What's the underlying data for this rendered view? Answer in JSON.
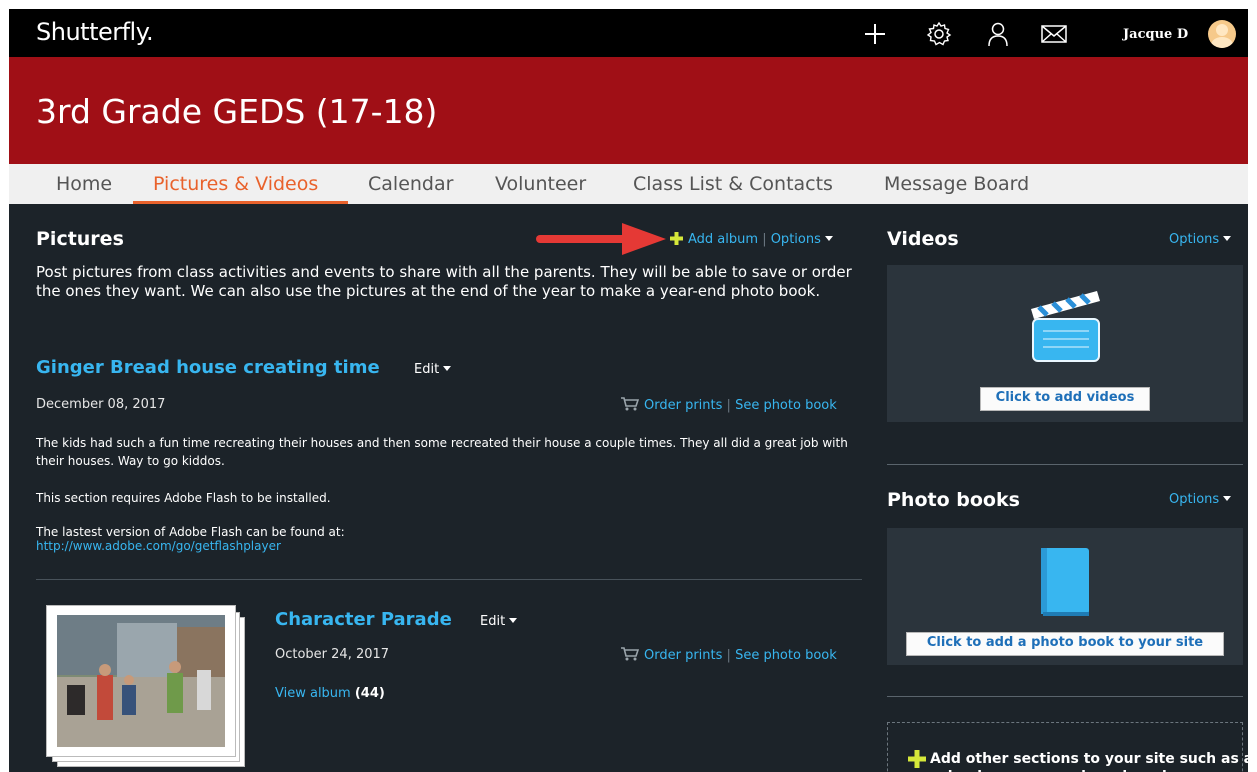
{
  "header": {
    "logo": "Shutterfly.",
    "user_name": "Jacque D",
    "icons": [
      "plus-icon",
      "gear-icon",
      "person-icon",
      "mail-icon"
    ]
  },
  "banner": {
    "title": "3rd Grade GEDS (17-18)"
  },
  "nav": {
    "items": [
      "Home",
      "Pictures & Videos",
      "Calendar",
      "Volunteer",
      "Class List & Contacts",
      "Message Board"
    ],
    "active": "Pictures & Videos"
  },
  "pictures": {
    "title": "Pictures",
    "add_album": "Add album",
    "options": "Options",
    "description": "Post pictures from class activities and events to share with all the parents. They will be able to save or order the ones they want. We can also use the pictures at the end of the year to make a year-end photo book.",
    "albums": [
      {
        "title": "Ginger Bread house creating time",
        "edit": "Edit",
        "date": "December 08, 2017",
        "order_prints": "Order prints",
        "see_photo_book": "See photo book",
        "body": "The kids had such a fun time recreating their houses and then some recreated their house a couple times. They all did a great job with their houses. Way to go kiddos.",
        "flash_notice": "This section requires Adobe Flash to be installed.",
        "flash_version": "The lastest version of Adobe Flash can be found at:",
        "flash_url": "http://www.adobe.com/go/getflashplayer"
      },
      {
        "title": "Character Parade",
        "edit": "Edit",
        "date": "October 24, 2017",
        "order_prints": "Order prints",
        "see_photo_book": "See photo book",
        "view_album": "View album",
        "count": "(44)"
      }
    ]
  },
  "videos": {
    "title": "Videos",
    "options": "Options",
    "add_button": "Click to add videos"
  },
  "photo_books": {
    "title": "Photo books",
    "options": "Options",
    "add_button": "Click to add a photo book to your site"
  },
  "add_sections": {
    "text": "Add other sections to your site such as a calendar, message board, and more"
  },
  "colors": {
    "banner": "#a00f16",
    "accent": "#e9622c",
    "link": "#38b6f0",
    "background": "#1c2329",
    "panel": "#2b343c",
    "arrow": "#e53935"
  }
}
